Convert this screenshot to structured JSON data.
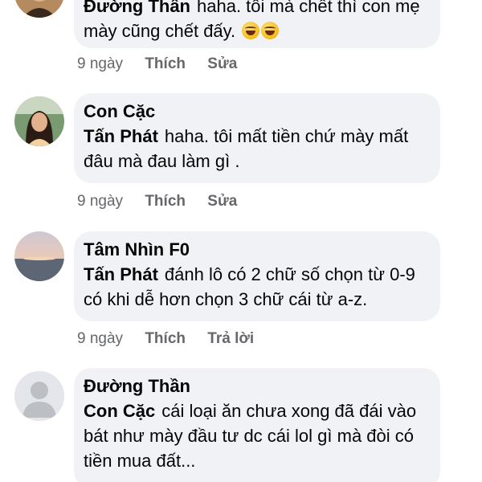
{
  "comments": [
    {
      "author": "Đường Thần",
      "text": "haha. tôi mà chết thì con mẹ mày cũng chết đấy.",
      "emojis": [
        "rolling-on-floor-laughing-emoji",
        "rolling-on-floor-laughing-emoji"
      ],
      "time": "9 ngày",
      "like": "Thích",
      "action": "Sửa"
    },
    {
      "author": "Con Cặc",
      "mention": "Tấn Phát",
      "text": "haha. tôi mất tiền chứ mày mất đâu mà đau làm gì .",
      "time": "9 ngày",
      "like": "Thích",
      "action": "Sửa"
    },
    {
      "author": "Tâm Nhìn F0",
      "mention": "Tấn Phát",
      "text": "đánh lô có 2 chữ số chọn từ 0-9 có khi dễ hơn chọn 3 chữ cái từ a-z.",
      "time": "9 ngày",
      "like": "Thích",
      "action": "Trả lời"
    },
    {
      "author": "Đường Thần",
      "mention": "Con Cặc",
      "text": "cái loại ăn chưa xong đã đái vào bát như mày đầu tư dc cái lol gì mà đòi có tiền mua đất...",
      "time": "",
      "like": "",
      "action": ""
    }
  ]
}
